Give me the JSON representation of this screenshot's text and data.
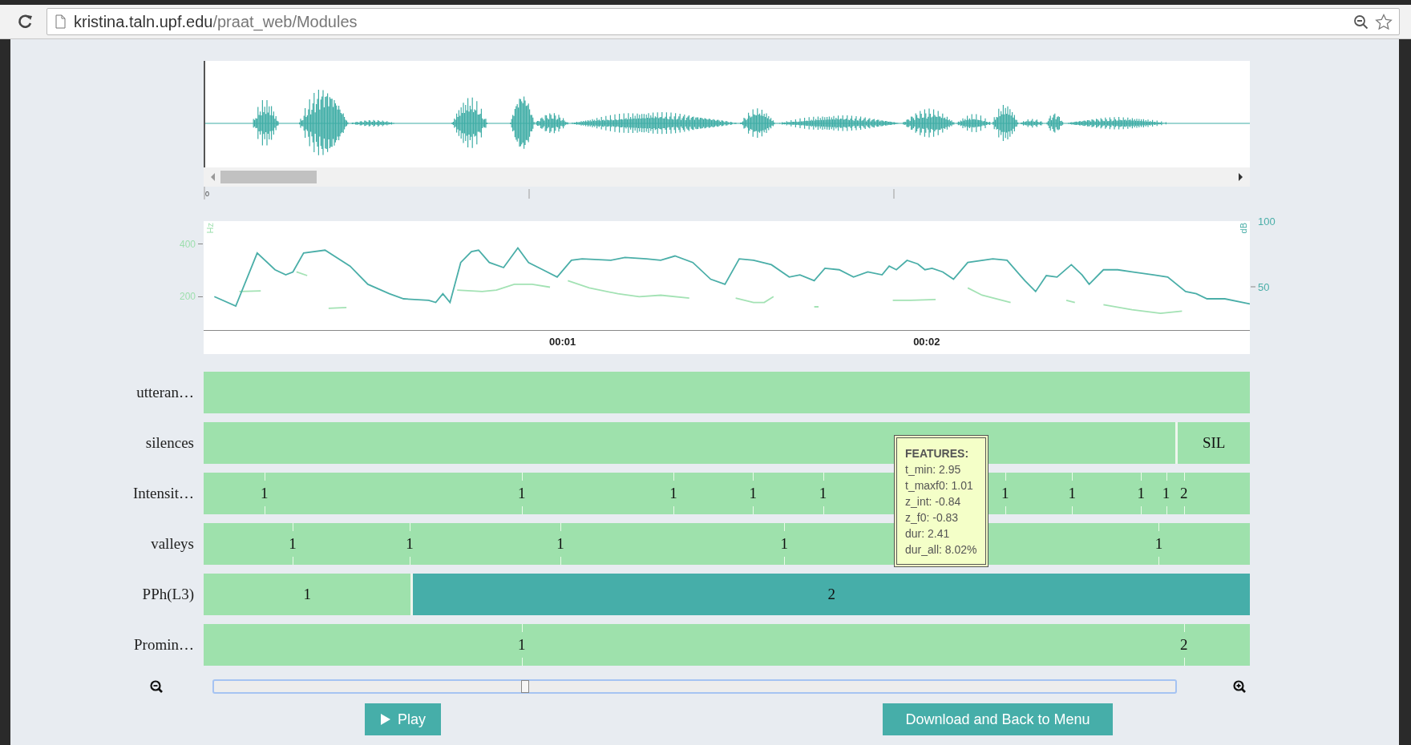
{
  "browser": {
    "url_host": "kristina.taln.upf.edu",
    "url_path": "/praat_web/Modules"
  },
  "waveform": {
    "start_label": "0"
  },
  "pitch_chart": {
    "left_unit": "Hz",
    "left_ticks": [
      "400",
      "200"
    ],
    "right_unit": "dB",
    "right_ticks": [
      "100",
      "50"
    ],
    "time_labels": [
      "00:01",
      "00:02"
    ]
  },
  "tiers": [
    {
      "name": "utteran…",
      "kind": "intervals",
      "intervals": [
        {
          "selected": false
        }
      ]
    },
    {
      "name": "silences",
      "kind": "intervals",
      "intervals": [
        {
          "selected": false
        },
        {
          "label": "SIL",
          "selected": false
        }
      ]
    },
    {
      "name": "Intensit…",
      "kind": "points",
      "points": [
        "1",
        "1",
        "1",
        "1",
        "1",
        "1",
        "1",
        "1",
        "1",
        "2"
      ]
    },
    {
      "name": "valleys",
      "kind": "points",
      "points": [
        "1",
        "1",
        "1",
        "1",
        "1"
      ]
    },
    {
      "name": "PPh(L3)",
      "kind": "intervals",
      "intervals": [
        {
          "label": "1",
          "selected": false
        },
        {
          "label": "2",
          "selected": true
        }
      ]
    },
    {
      "name": "Promin…",
      "kind": "points",
      "points": [
        "1",
        "2"
      ]
    }
  ],
  "tooltip": {
    "title": "FEATURES:",
    "lines": [
      "t_min: 2.95",
      "t_maxf0: 1.01",
      "z_int: -0.84",
      "z_f0: -0.83",
      "dur: 2.41",
      "dur_all: 8.02%"
    ]
  },
  "zoom_slider": {
    "level": 0.324
  },
  "buttons": [
    {
      "kind": "play",
      "label": "Play"
    },
    {
      "kind": "plain",
      "label": "Download and Back to Menu"
    }
  ]
}
